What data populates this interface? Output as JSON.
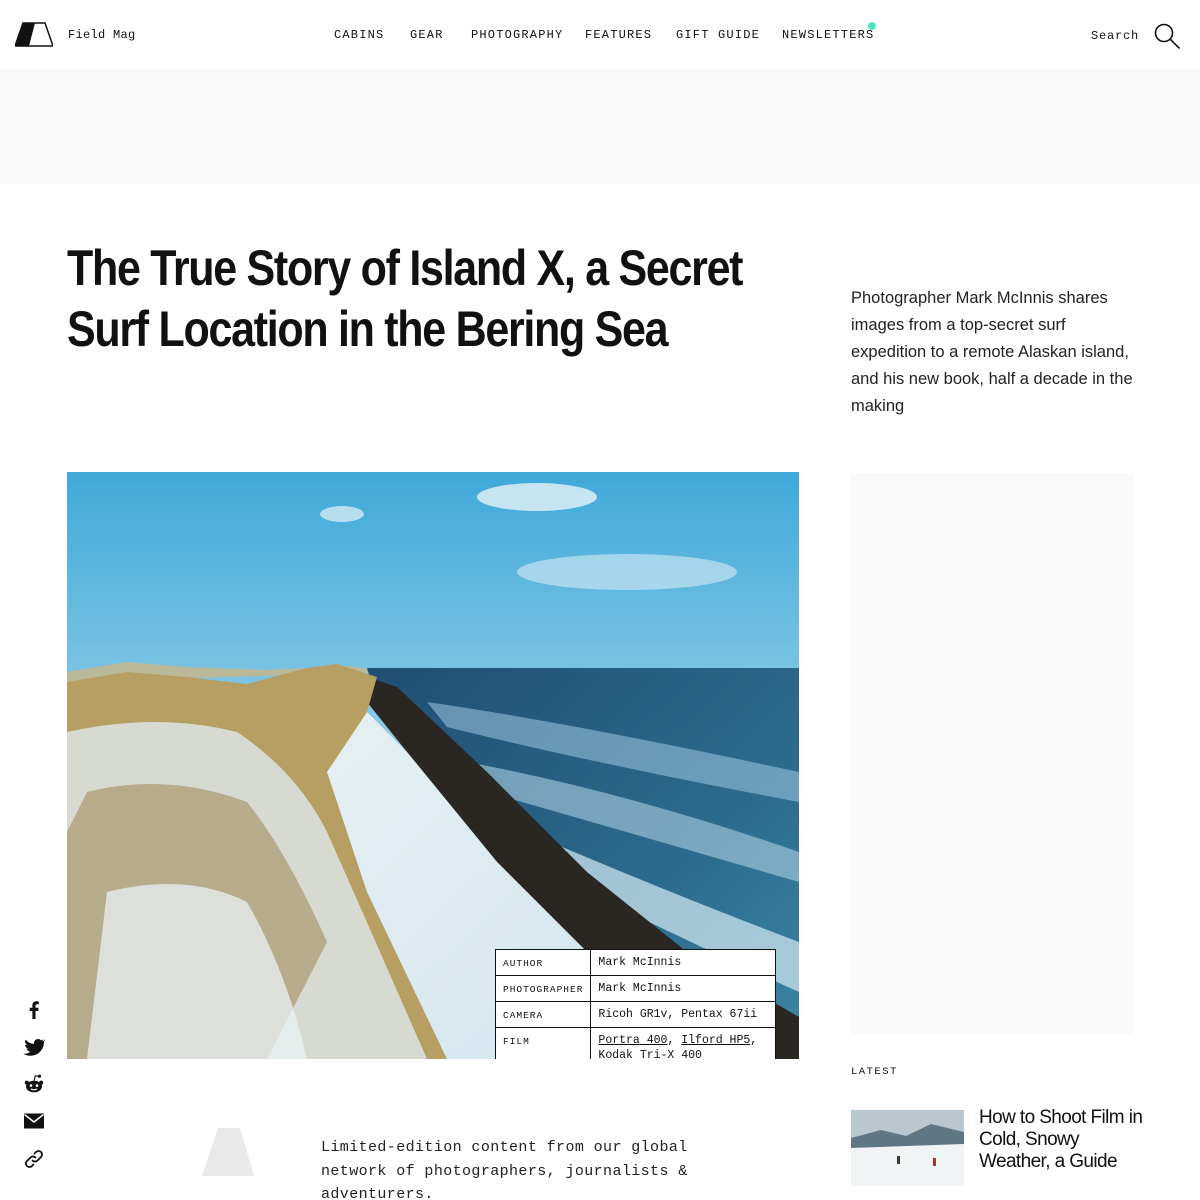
{
  "header": {
    "brand": "Field Mag",
    "nav": [
      "CABINS",
      "GEAR",
      "PHOTOGRAPHY",
      "FEATURES",
      "GIFT GUIDE",
      "NEWSLETTERS"
    ],
    "search_label": "Search"
  },
  "article": {
    "title": "The True Story of Island X, a Secret Surf Location in the Bering Sea",
    "dek": "Photographer Mark McInnis shares images from a top-secret surf expedition to a remote Alaskan island, and his new book, half a decade in the making"
  },
  "credits": {
    "author_label": "AUTHOR",
    "author": "Mark McInnis",
    "photographer_label": "PHOTOGRAPHER",
    "photographer": "Mark McInnis",
    "camera_label": "CAMERA",
    "camera": "Ricoh GR1v, Pentax 67ii",
    "film_label": "FILM",
    "film": [
      "Portra 400",
      "Ilford HP5",
      "Kodak Tri-X 400"
    ],
    "film_sep": ", "
  },
  "sidebar": {
    "latest_label": "LATEST",
    "latest_title": "How to Shoot Film in Cold, Snowy Weather, a Guide"
  },
  "share": [
    "facebook-icon",
    "twitter-icon",
    "reddit-icon",
    "email-icon",
    "link-icon"
  ],
  "promo": {
    "text": "Limited-edition content from our global network of photographers, journalists & adventurers."
  },
  "colors": {
    "accent_dot": "#4fe3c1",
    "ad_background": "#f8f8f8"
  }
}
